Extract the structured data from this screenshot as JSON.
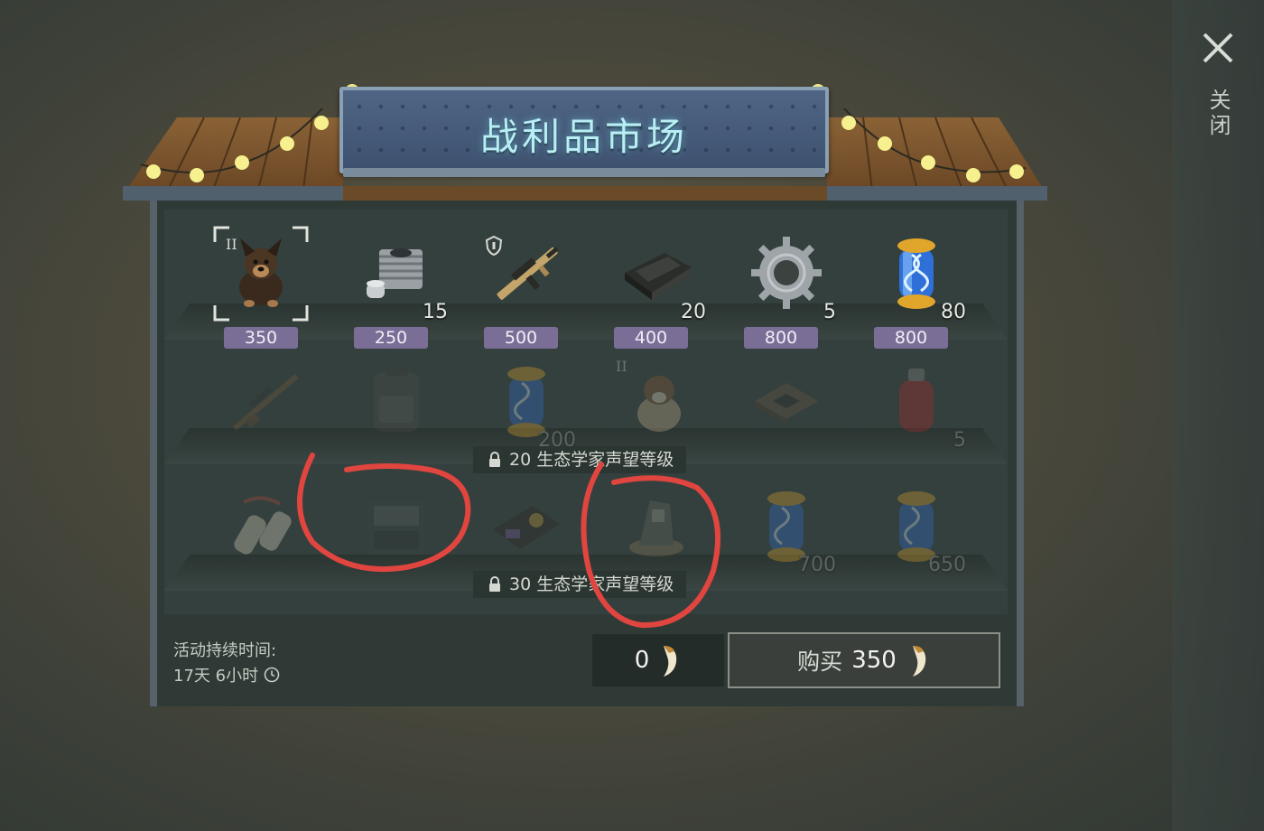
{
  "window": {
    "title": "战利品市场",
    "close_label": "关闭"
  },
  "shelf_rows": [
    {
      "locked": false,
      "items": [
        {
          "icon": "puppy-icon",
          "quantity": "",
          "badge": "II",
          "price": "350",
          "selected": true
        },
        {
          "icon": "engine-cylinder-icon",
          "quantity": "15",
          "price": "250"
        },
        {
          "icon": "rifle-icon",
          "quantity": "",
          "badge_icon": "shield-icon",
          "price": "500"
        },
        {
          "icon": "leather-icon",
          "quantity": "20",
          "price": "400"
        },
        {
          "icon": "gear-icon",
          "quantity": "5",
          "price": "800"
        },
        {
          "icon": "dna-capsule-icon",
          "quantity": "80",
          "price": "800"
        }
      ]
    },
    {
      "locked": true,
      "lock_text": "20 生态学家声望等级",
      "items": [
        {
          "icon": "sniper-rifle-icon",
          "quantity": ""
        },
        {
          "icon": "backpack-icon",
          "quantity": ""
        },
        {
          "icon": "dna-capsule-icon",
          "quantity": "200"
        },
        {
          "icon": "dog-icon",
          "quantity": "",
          "badge": "II"
        },
        {
          "icon": "circuit-board-icon",
          "quantity": ""
        },
        {
          "icon": "gas-tank-icon",
          "quantity": "5"
        }
      ]
    },
    {
      "locked": true,
      "lock_text": "30 生态学家声望等级",
      "items": [
        {
          "icon": "bandage-supplies-icon",
          "quantity": ""
        },
        {
          "icon": "toolbox-icon",
          "quantity": ""
        },
        {
          "icon": "badge-wallet-icon",
          "quantity": ""
        },
        {
          "icon": "scrap-pile-icon",
          "quantity": ""
        },
        {
          "icon": "dna-capsule-icon",
          "quantity": "700"
        },
        {
          "icon": "dna-capsule-icon",
          "quantity": "650"
        }
      ]
    }
  ],
  "footer": {
    "duration_label": "活动持续时间:",
    "duration_value": "17天 6小时",
    "balance": "0",
    "buy_label": "购买",
    "buy_price": "350",
    "currency_icon": "fang-icon"
  },
  "colors": {
    "price_tag": "#7a6e97",
    "title_text": "#b8eef4",
    "sign": "#4f6584",
    "annotation": "#e0453f",
    "bulb": "#f4ee8a"
  }
}
